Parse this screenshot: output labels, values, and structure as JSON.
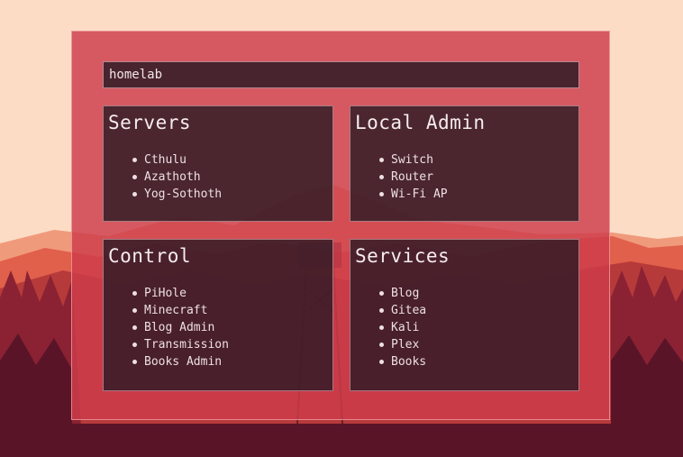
{
  "search": {
    "value": "homelab"
  },
  "cards": [
    {
      "title": "Servers",
      "items": [
        "Cthulu",
        "Azathoth",
        "Yog-Sothoth"
      ]
    },
    {
      "title": "Local Admin",
      "items": [
        "Switch",
        "Router",
        "Wi-Fi AP"
      ]
    },
    {
      "title": "Control",
      "items": [
        "PiHole",
        "Minecraft",
        "Blog Admin",
        "Transmission",
        "Books Admin"
      ]
    },
    {
      "title": "Services",
      "items": [
        "Blog",
        "Gitea",
        "Kali",
        "Plex",
        "Books"
      ]
    }
  ],
  "colors": {
    "sky": "#fcdcc5",
    "panel": "#cd3c4b",
    "card": "#281923",
    "text": "#f3e6ea"
  },
  "background_icon": "forest-lookout-tower-wallpaper"
}
